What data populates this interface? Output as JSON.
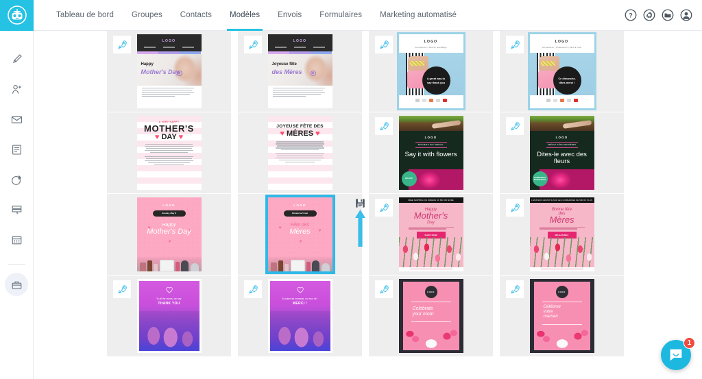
{
  "app": {
    "logo_name": "sendinblue-robot-logo",
    "accent": "#25c2e3",
    "badge_red": "#ef4b3f"
  },
  "nav": {
    "items": [
      {
        "label": "Tableau de bord",
        "active": false
      },
      {
        "label": "Groupes",
        "active": false
      },
      {
        "label": "Contacts",
        "active": false
      },
      {
        "label": "Modèles",
        "active": true
      },
      {
        "label": "Envois",
        "active": false
      },
      {
        "label": "Formulaires",
        "active": false
      },
      {
        "label": "Marketing automatisé",
        "active": false
      }
    ]
  },
  "topbar_right": {
    "items": [
      {
        "name": "help-icon",
        "label": "?"
      },
      {
        "name": "gear-icon",
        "label": "Paramètres"
      },
      {
        "name": "folder-icon",
        "label": "Dossiers"
      },
      {
        "name": "account-icon",
        "label": "Compte"
      }
    ]
  },
  "sidebar": {
    "items": [
      {
        "name": "sidebar-item-design",
        "label": "Design",
        "highlight": false
      },
      {
        "name": "sidebar-item-add-contact",
        "label": "Ajouter un contact",
        "highlight": false
      },
      {
        "name": "sidebar-item-email",
        "label": "Email",
        "highlight": false
      },
      {
        "name": "sidebar-item-form",
        "label": "Formulaire",
        "highlight": false
      },
      {
        "name": "sidebar-item-statistics",
        "label": "Statistiques",
        "highlight": false
      },
      {
        "name": "sidebar-item-landing-page",
        "label": "Landing page",
        "highlight": false
      },
      {
        "name": "sidebar-item-calendar",
        "label": "Calendrier",
        "highlight": false
      },
      {
        "name": "sidebar-item-toolbox",
        "label": "Boîte à outils",
        "highlight": true
      }
    ]
  },
  "annotations": {
    "arrow_left_target": "sidebar-item-design",
    "arrow_up_target": "save-template-icon",
    "color": "#3bbdea"
  },
  "templates": {
    "cards": [
      {
        "id": "card-spa-en",
        "style": "spa",
        "rocket": true,
        "selected": false,
        "logo": "LOGO",
        "nav": [
          "Massage",
          "Esthétique",
          "Soins"
        ],
        "heading1": "Happy",
        "heading2": "Mother's Day",
        "body_lines": 6
      },
      {
        "id": "card-spa-fr",
        "style": "spa",
        "rocket": true,
        "selected": false,
        "logo": "LOGO",
        "nav": [
          "Massage",
          "Esthétique",
          "Soins"
        ],
        "heading1": "Joyeuse fête",
        "heading2": "des Mères",
        "body_lines": 6
      },
      {
        "id": "card-gift-en",
        "style": "blue-gift",
        "rocket": true,
        "selected": false,
        "logo": "LOGO",
        "subtitle": "Accessories | Shoes | Handbags",
        "circle_text": "A great way to say thank you",
        "body_lines": 4
      },
      {
        "id": "card-gift-fr",
        "style": "blue-gift",
        "rocket": true,
        "selected": false,
        "logo": "LOGO",
        "subtitle": "Accessoires | Chaussures | Sacs à main",
        "circle_text": "Ce dimanche, dites merci !",
        "body_lines": 4
      },
      {
        "id": "card-stripes-en",
        "style": "stripes-en",
        "rocket": false,
        "selected": false,
        "kicker": "A VERY HAPPY",
        "title1": "MOTHER'S",
        "title2": "DAY",
        "body_lines": 10
      },
      {
        "id": "card-stripes-fr",
        "style": "stripes-fr",
        "rocket": false,
        "selected": false,
        "title1": "JOYEUSE FÊTE DES",
        "title2": "MÈRES",
        "body_lines": 10
      },
      {
        "id": "card-flowers-en",
        "style": "green-flowers",
        "rocket": true,
        "selected": false,
        "logo": "LOGO",
        "tagline": "MOTHER'S DAY SPECIAL",
        "heading": "Say it with flowers",
        "badge": "20% OFF"
      },
      {
        "id": "card-flowers-fr",
        "style": "green-flowers",
        "rocket": true,
        "selected": false,
        "logo": "LOGO",
        "tagline": "SPÉCIAL FÊTE DES MÈRES",
        "heading": "Dites-le avec des fleurs",
        "badge": "COMMANDEZ MAINTENANT"
      },
      {
        "id": "card-makeup-en",
        "style": "pink-makeup",
        "rocket": false,
        "selected": false,
        "logo": "LOGO",
        "pill": "Sunday, May 8",
        "heading1": "Happy",
        "heading2": "Mother's Day"
      },
      {
        "id": "card-makeup-fr",
        "style": "pink-makeup",
        "rocket": false,
        "selected": true,
        "logo": "LOGO",
        "pill": "Dimanche 5 mai",
        "heading1": "Fête des",
        "heading2": "Mères"
      },
      {
        "id": "card-tulips-en",
        "style": "tulips",
        "rocket": true,
        "selected": false,
        "topbar": "FREE SHIPPING ON ORDERS OF $50 OR MORE",
        "heading1": "Happy",
        "heading2": "Mother's",
        "heading3": "Day",
        "button": "SHOP NOW"
      },
      {
        "id": "card-tulips-fr",
        "style": "tulips",
        "rocket": true,
        "selected": false,
        "topbar": "LIVRAISON GRATUITE SUR LES COMMANDES DE 50€ OU PLUS",
        "heading1": "Bonne fête",
        "heading2": "des",
        "heading3": "Mères",
        "button": "MAGASINEZ"
      },
      {
        "id": "card-thanks-en",
        "style": "purple-thanks",
        "rocket": true,
        "selected": false,
        "line1": "To all the moms, we say:",
        "line2": "THANK YOU"
      },
      {
        "id": "card-thanks-fr",
        "style": "purple-thanks",
        "rocket": true,
        "selected": false,
        "line1": "À toutes les mamans, on vous dit :",
        "line2": "MERCI !"
      },
      {
        "id": "card-celebrate-en",
        "style": "celebrate",
        "rocket": true,
        "selected": false,
        "logo": "LOGO",
        "heading1": "Celebrate",
        "heading2": "your mom"
      },
      {
        "id": "card-celebrate-fr",
        "style": "celebrate",
        "rocket": true,
        "selected": false,
        "logo": "LOGO",
        "heading1": "Célébrez",
        "heading2": "votre",
        "heading3": "maman"
      }
    ]
  },
  "save_action": {
    "name": "save-template-icon",
    "label": "Enregistrer"
  },
  "intercom": {
    "name": "intercom-launcher",
    "unread": "1"
  }
}
